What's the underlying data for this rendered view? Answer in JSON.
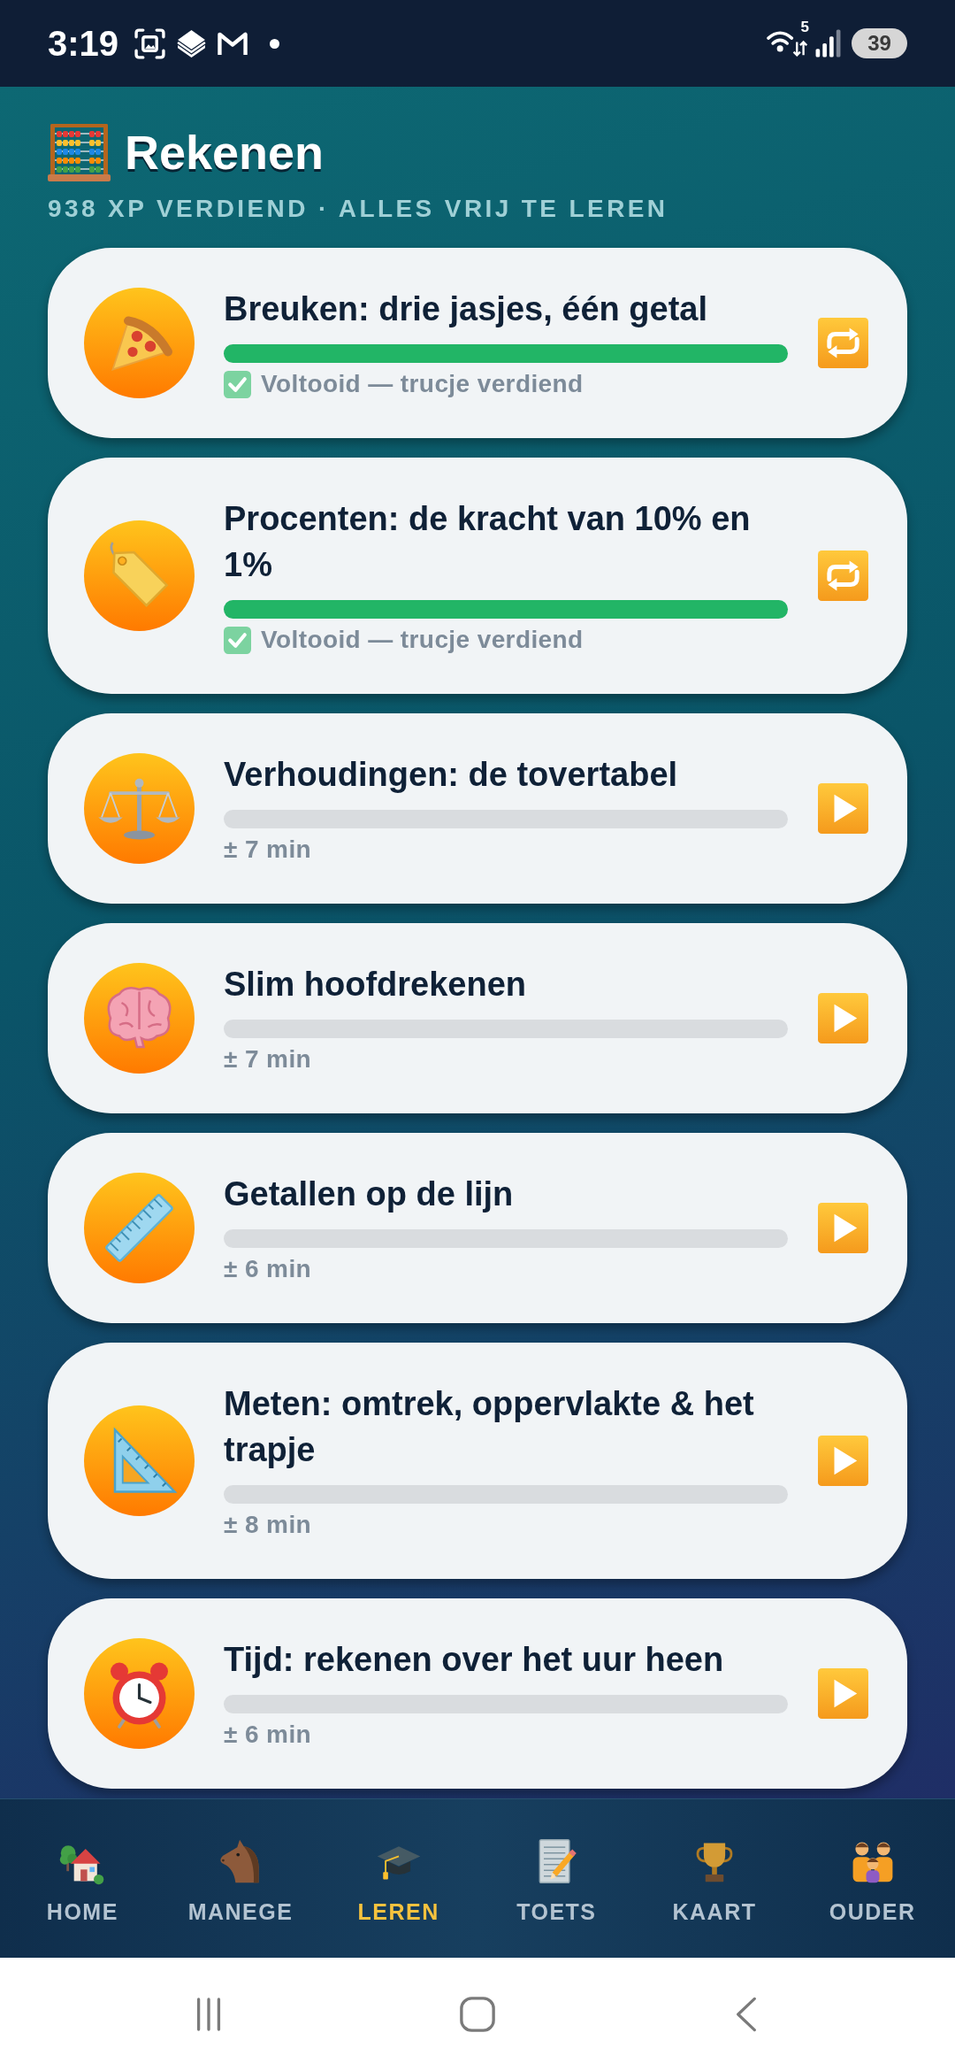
{
  "status_bar": {
    "time": "3:19",
    "network": "5",
    "battery": "39"
  },
  "header": {
    "title": "Rekenen",
    "subtitle": "938 XP VERDIEND · ALLES VRIJ TE LEREN"
  },
  "lessons": [
    {
      "title": "Breuken: drie jasjes, één getal",
      "level": 1,
      "completed": true,
      "note": "Voltooid — trucje verdiend"
    },
    {
      "title": "Procenten: de kracht van 10% en 1%",
      "level": 1,
      "completed": true,
      "note": "Voltooid — trucje verdiend"
    },
    {
      "title": "Verhoudingen: de tovertabel",
      "completed": false,
      "note": "± 7 min"
    },
    {
      "title": "Slim hoofdrekenen",
      "completed": false,
      "note": "± 7 min"
    },
    {
      "title": "Getallen op de lijn",
      "completed": false,
      "note": "± 6 min"
    },
    {
      "title": "Meten: omtrek, oppervlakte & het trapje",
      "completed": false,
      "note": "± 8 min"
    },
    {
      "title": "Tijd: rekenen over het uur heen",
      "completed": false,
      "note": "± 6 min"
    }
  ],
  "bottom_nav": [
    {
      "label": "HOME",
      "selected": false
    },
    {
      "label": "MANEGE",
      "selected": false
    },
    {
      "label": "LEREN",
      "selected": true
    },
    {
      "label": "TOETS",
      "selected": false
    },
    {
      "label": "KAART",
      "selected": false
    },
    {
      "label": "OUDER",
      "selected": false
    }
  ]
}
